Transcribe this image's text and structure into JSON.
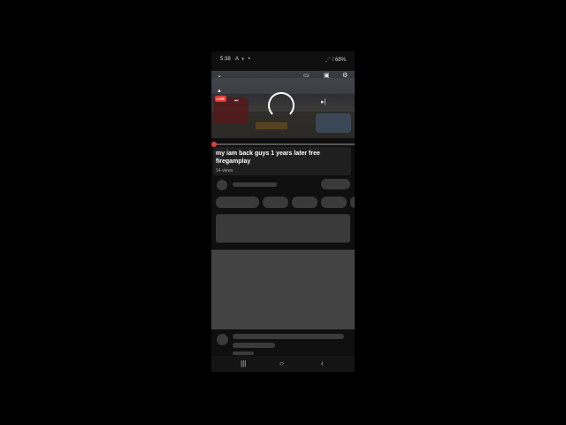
{
  "statusbar": {
    "time": "5:38",
    "notifications": "A ◐ •",
    "right": "⋰ ⁞ 68%"
  },
  "player": {
    "live_label": "LIVE",
    "icons": {
      "collapse": "chevron-down-icon",
      "cast": "cast-icon",
      "captions": "captions-icon",
      "settings": "gear-icon",
      "skip_next": "skip-next-icon"
    }
  },
  "video": {
    "title": "my iam back guys 1 years later free firegamplay",
    "views": "14 views"
  },
  "navbar": {
    "recents": "|||",
    "home": "○",
    "back": "‹"
  }
}
